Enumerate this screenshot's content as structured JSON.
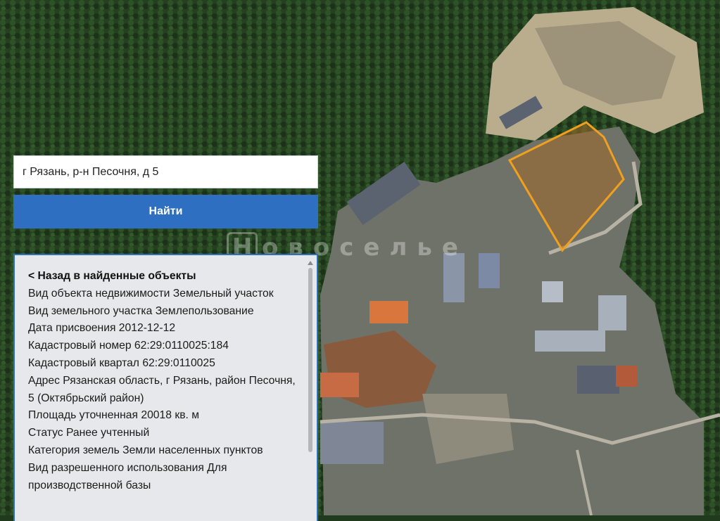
{
  "search": {
    "value": "г Рязань, р-н Песочня, д 5",
    "button_label": "Найти"
  },
  "watermark": {
    "first_letter": "Н",
    "rest": "овоселье"
  },
  "details": {
    "back_label": "< Назад в найденные объекты",
    "rows": [
      "Вид объекта недвижимости Земельный участок",
      "Вид земельного участка Землепользование",
      "Дата присвоения 2012-12-12",
      "Кадастровый номер 62:29:0110025:184",
      "Кадастровый квартал 62:29:0110025",
      "Адрес Рязанская область, г Рязань, район Песочня, 5 (Октябрьский район)",
      "Площадь уточненная 20018 кв. м",
      "Статус Ранее учтенный",
      "Категория земель Земли населенных пунктов",
      "Вид разрешенного использования Для производственной базы"
    ]
  },
  "colors": {
    "accent": "#2f6fc1",
    "parcel_outline": "#f0a020",
    "forest": "#233f1f",
    "panel_bg": "#e7e8ec"
  }
}
